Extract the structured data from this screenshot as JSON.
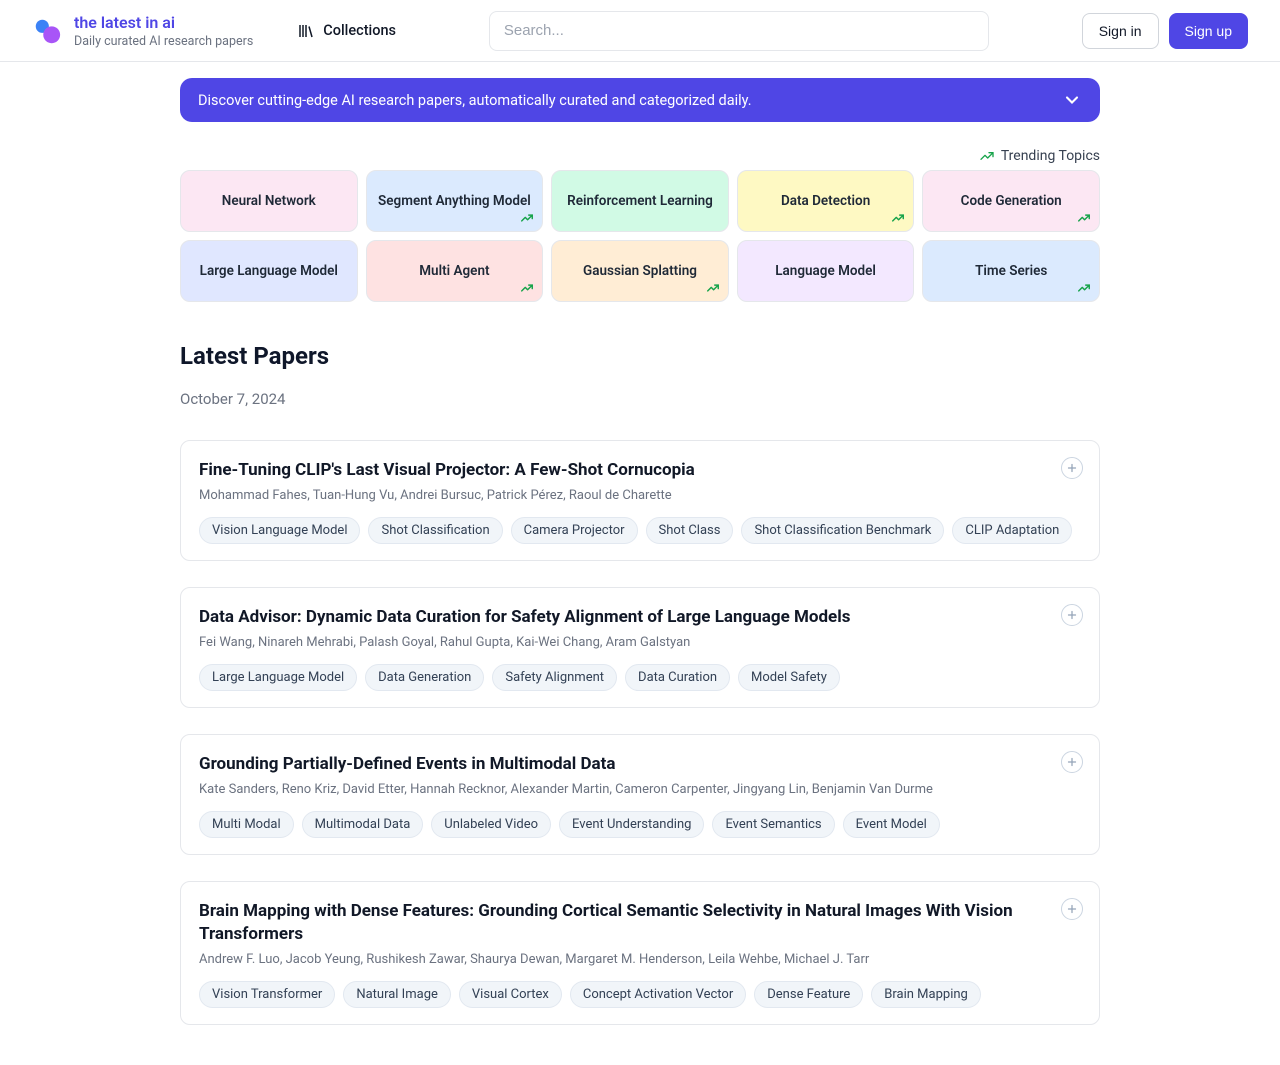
{
  "header": {
    "brand_title": "the latest in ai",
    "brand_sub": "Daily curated AI research papers",
    "collections_label": "Collections",
    "search_placeholder": "Search...",
    "sign_in": "Sign in",
    "sign_up": "Sign up"
  },
  "banner_text": "Discover cutting-edge AI research papers, automatically curated and categorized daily.",
  "trending_label": "Trending Topics",
  "topics": [
    {
      "label": "Neural Network",
      "bg": "#fce7f3",
      "trending": false
    },
    {
      "label": "Segment Anything Model",
      "bg": "#dbeafe",
      "trending": true
    },
    {
      "label": "Reinforcement Learning",
      "bg": "#d1fae5",
      "trending": false
    },
    {
      "label": "Data Detection",
      "bg": "#fef9c3",
      "trending": true
    },
    {
      "label": "Code Generation",
      "bg": "#fce7f3",
      "trending": true
    },
    {
      "label": "Large Language Model",
      "bg": "#e0e7ff",
      "trending": false
    },
    {
      "label": "Multi Agent",
      "bg": "#fee2e2",
      "trending": true
    },
    {
      "label": "Gaussian Splatting",
      "bg": "#ffedd5",
      "trending": true
    },
    {
      "label": "Language Model",
      "bg": "#f3e8ff",
      "trending": false
    },
    {
      "label": "Time Series",
      "bg": "#dbeafe",
      "trending": true
    }
  ],
  "section_title": "Latest Papers",
  "date": "October 7, 2024",
  "papers": [
    {
      "title": "Fine-Tuning CLIP's Last Visual Projector: A Few-Shot Cornucopia",
      "authors": "Mohammad Fahes, Tuan-Hung Vu, Andrei Bursuc, Patrick Pérez, Raoul de Charette",
      "tags": [
        "Vision Language Model",
        "Shot Classification",
        "Camera Projector",
        "Shot Class",
        "Shot Classification Benchmark",
        "CLIP Adaptation"
      ]
    },
    {
      "title": "Data Advisor: Dynamic Data Curation for Safety Alignment of Large Language Models",
      "authors": "Fei Wang, Ninareh Mehrabi, Palash Goyal, Rahul Gupta, Kai-Wei Chang, Aram Galstyan",
      "tags": [
        "Large Language Model",
        "Data Generation",
        "Safety Alignment",
        "Data Curation",
        "Model Safety"
      ]
    },
    {
      "title": "Grounding Partially-Defined Events in Multimodal Data",
      "authors": "Kate Sanders, Reno Kriz, David Etter, Hannah Recknor, Alexander Martin, Cameron Carpenter, Jingyang Lin, Benjamin Van Durme",
      "tags": [
        "Multi Modal",
        "Multimodal Data",
        "Unlabeled Video",
        "Event Understanding",
        "Event Semantics",
        "Event Model"
      ]
    },
    {
      "title": "Brain Mapping with Dense Features: Grounding Cortical Semantic Selectivity in Natural Images With Vision Transformers",
      "authors": "Andrew F. Luo, Jacob Yeung, Rushikesh Zawar, Shaurya Dewan, Margaret M. Henderson, Leila Wehbe, Michael J. Tarr",
      "tags": [
        "Vision Transformer",
        "Natural Image",
        "Visual Cortex",
        "Concept Activation Vector",
        "Dense Feature",
        "Brain Mapping"
      ]
    }
  ]
}
